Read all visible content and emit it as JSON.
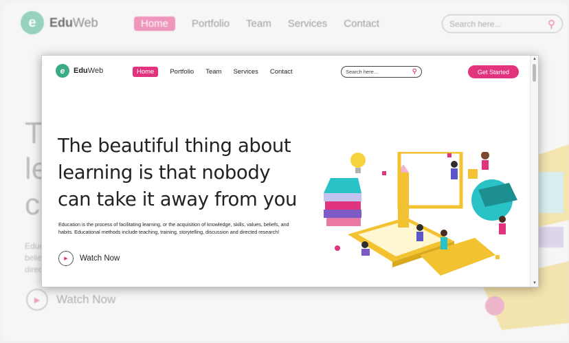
{
  "background_page": {
    "logo_icon": "e",
    "logo_text_a": "Edu",
    "logo_text_b": "Web",
    "nav": [
      "Home",
      "Portfolio",
      "Team",
      "Services",
      "Contact"
    ],
    "search_placeholder": "Search here...",
    "heading_lines": [
      "T",
      "le",
      "c"
    ],
    "body_lines": [
      "Educ",
      "belie",
      "direc"
    ],
    "watch_label": "Watch Now"
  },
  "window": {
    "logo_icon": "e",
    "logo_text_a": "Edu",
    "logo_text_b": "Web",
    "nav": {
      "home": "Home",
      "portfolio": "Portfolio",
      "team": "Team",
      "services": "Services",
      "contact": "Contact"
    },
    "search_placeholder": "Search here...",
    "cta_label": "Get Started",
    "hero_title": "The beautiful thing about learning is that nobody can take it away from you",
    "hero_text": "Education is the process of facilitating learning, or the acquisition of knowledge, skills, values, beliefs, and habits. Educational methods include teaching, training, storytelling, discussion and directed research!",
    "watch_label": "Watch Now"
  },
  "icons": {
    "search": "magnifier-icon",
    "play": "play-icon",
    "scroll_up": "triangle-up-icon",
    "scroll_down": "triangle-down-icon"
  },
  "colors": {
    "brand_pink": "#e2347e",
    "brand_green": "#3aab84",
    "illustration_teal": "#29c2c6",
    "illustration_yellow": "#f2c230"
  }
}
